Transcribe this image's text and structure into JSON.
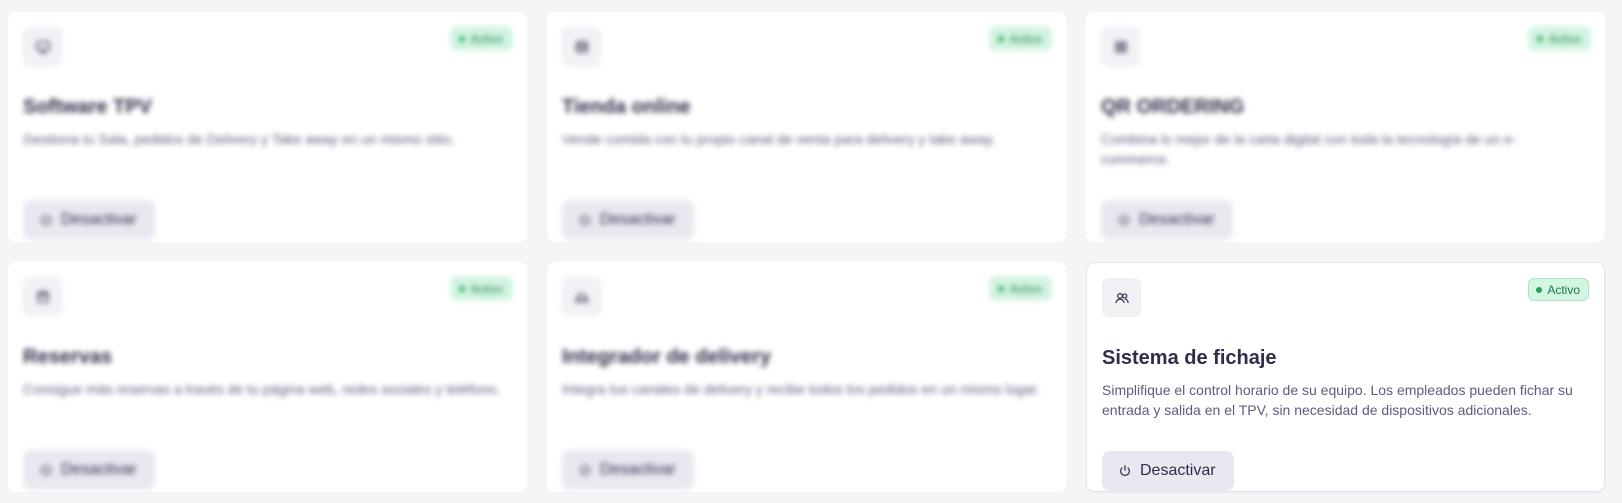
{
  "colors": {
    "card_bg": "#ffffff",
    "page_bg": "#f5f5f8",
    "badge_bg": "#d3f5e2",
    "badge_text": "#1a7a46",
    "badge_dot": "#22a55a",
    "button_bg": "#e8e8f0",
    "title": "#2d2e48",
    "description": "#5c5d7e"
  },
  "cards": [
    {
      "icon": "monitor-icon",
      "badge": "Activo",
      "title": "Software TPV",
      "description": "Gestiona tu Sala, pedidos de Delivery y Take away en un mismo sitio.",
      "button": "Desactivar",
      "blurred": true
    },
    {
      "icon": "store-icon",
      "badge": "Activo",
      "title": "Tienda online",
      "description": "Vende comida con tu propio canal de venta para delivery y take away.",
      "button": "Desactivar",
      "blurred": true
    },
    {
      "icon": "qr-code-icon",
      "badge": "Activo",
      "title": "QR ORDERING",
      "description": "Combina lo mejor de la carta digital con toda la tecnología de un e-commerce.",
      "button": "Desactivar",
      "blurred": true
    },
    {
      "icon": "calendar-icon",
      "badge": "Activo",
      "title": "Reservas",
      "description": "Consigue más reservas a través de tu página web, redes sociales y teléfono.",
      "button": "Desactivar",
      "blurred": true
    },
    {
      "icon": "delivery-scooter-icon",
      "badge": "Activo",
      "title": "Integrador de delivery",
      "description": "Integra tus canales de delivery y recibe todos los pedidos en un mismo lugar.",
      "button": "Desactivar",
      "blurred": true
    },
    {
      "icon": "users-icon",
      "badge": "Activo",
      "title": "Sistema de fichaje",
      "description": "Simplifique el control horario de su equipo. Los empleados pueden fichar su entrada y salida en el TPV, sin necesidad de dispositivos adicionales.",
      "button": "Desactivar",
      "blurred": false
    }
  ]
}
